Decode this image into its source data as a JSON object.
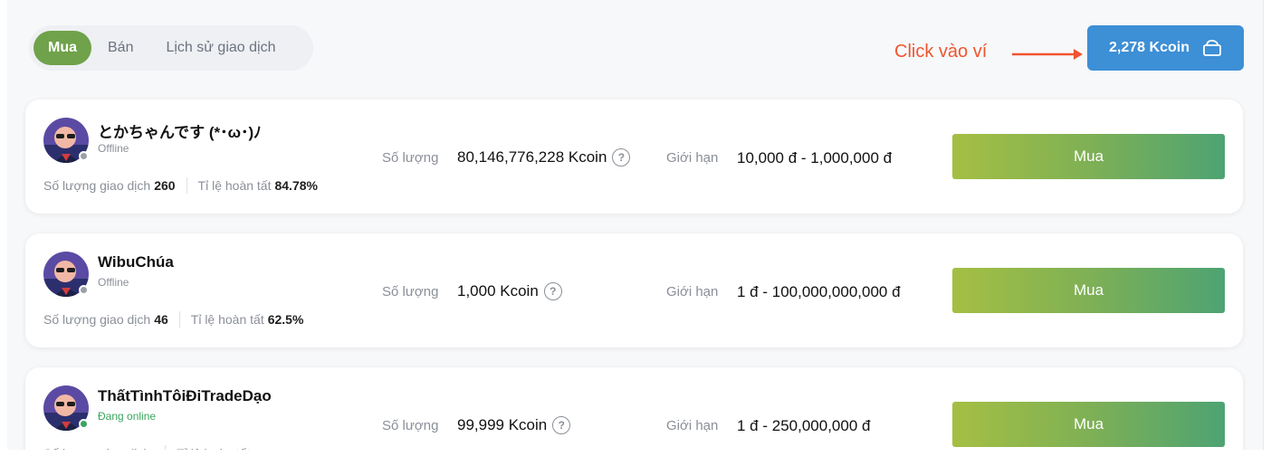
{
  "tabs": [
    {
      "label": "Mua",
      "active": true
    },
    {
      "label": "Bán",
      "active": false
    },
    {
      "label": "Lịch sử giao dịch",
      "active": false
    }
  ],
  "annotation": "Click vào ví",
  "wallet": {
    "label": "2,278 Kcoin",
    "icon": "wallet-icon"
  },
  "labels": {
    "quantity": "Số lượng",
    "limit": "Giới hạn",
    "trades": "Số lượng giao dịch",
    "completion": "Tỉ lệ hoàn tất",
    "buy": "Mua",
    "help": "?"
  },
  "colors": {
    "accent_green": "#6fa24a",
    "wallet_blue": "#3d8fd6",
    "annotation_red": "#f0552f",
    "online": "#3aa55d",
    "offline": "#9aa0a8"
  },
  "sellers": [
    {
      "name": "とかちゃんです (*･ω･)ﾉ",
      "status": "Offline",
      "online": false,
      "trades": "260",
      "completion": "84.78%",
      "quantity": "80,146,776,228 Kcoin",
      "limit": "10,000 đ - 1,000,000 đ"
    },
    {
      "name": "WibuChúa",
      "status": "Offline",
      "online": false,
      "trades": "46",
      "completion": "62.5%",
      "quantity": "1,000 Kcoin",
      "limit": "1 đ - 100,000,000,000 đ"
    },
    {
      "name": "ThấtTìnhTôiĐiTradeDạo",
      "status": "Đang online",
      "online": true,
      "trades": "",
      "completion": "",
      "quantity": "99,999 Kcoin",
      "limit": "1 đ - 250,000,000 đ"
    }
  ]
}
